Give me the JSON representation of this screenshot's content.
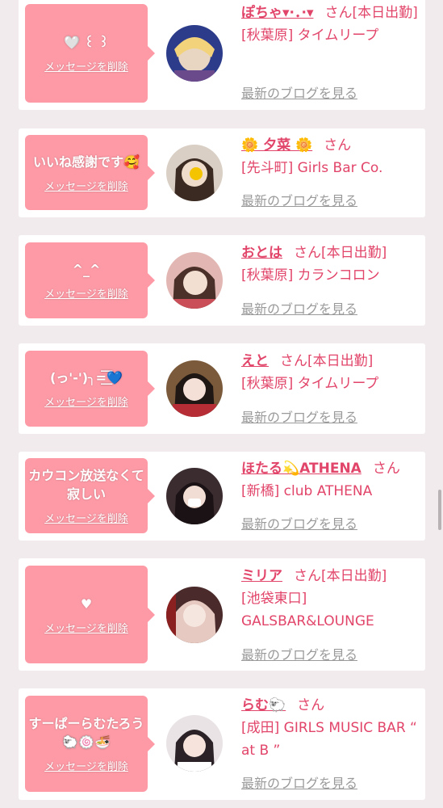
{
  "labels": {
    "delete": "メッセージを削除",
    "blog": "最新のブログを見る",
    "san": "さん"
  },
  "items": [
    {
      "message": "🤍 ꒰ ꒱",
      "name": "ぽちゃ▾·．·▾",
      "shop_line1": "[本日出勤]",
      "shop_line2": "[秋葉原] タイムリープ"
    },
    {
      "message": "いいね感謝です🥰",
      "name": "🌼 夕菜 🌼",
      "shop_line1": "",
      "shop_line2": "[先斗町] Girls Bar Co."
    },
    {
      "message": "^_^",
      "name": "おとは",
      "shop_line1": "[本日出勤]",
      "shop_line2": "[秋葉原] カランコロン"
    },
    {
      "message": "(っ'-')╮=͟͟͞͞💙",
      "name": "えと",
      "shop_line1": "[本日出勤]",
      "shop_line2": "[秋葉原] タイムリープ"
    },
    {
      "message": "カウコン放送なくて寂しい",
      "name": "ほたる💫ATHENA",
      "shop_line1": "",
      "shop_line2": "[新橋] club ATHENA"
    },
    {
      "message": "♥",
      "name": "ミリア",
      "shop_line1": "[本日出勤]",
      "shop_line2": "[池袋東口] GALSBAR&LOUNGE"
    },
    {
      "message": "すーぱーらむたろう🐑🍥🍜",
      "name": "らむ🐑",
      "shop_line1": "",
      "shop_line2": "[成田] GIRLS MUSIC BAR “ at B ”"
    }
  ],
  "colors": {
    "accent": "#e2456a",
    "bubble": "#fd9aa6",
    "background": "#f1ebed"
  }
}
